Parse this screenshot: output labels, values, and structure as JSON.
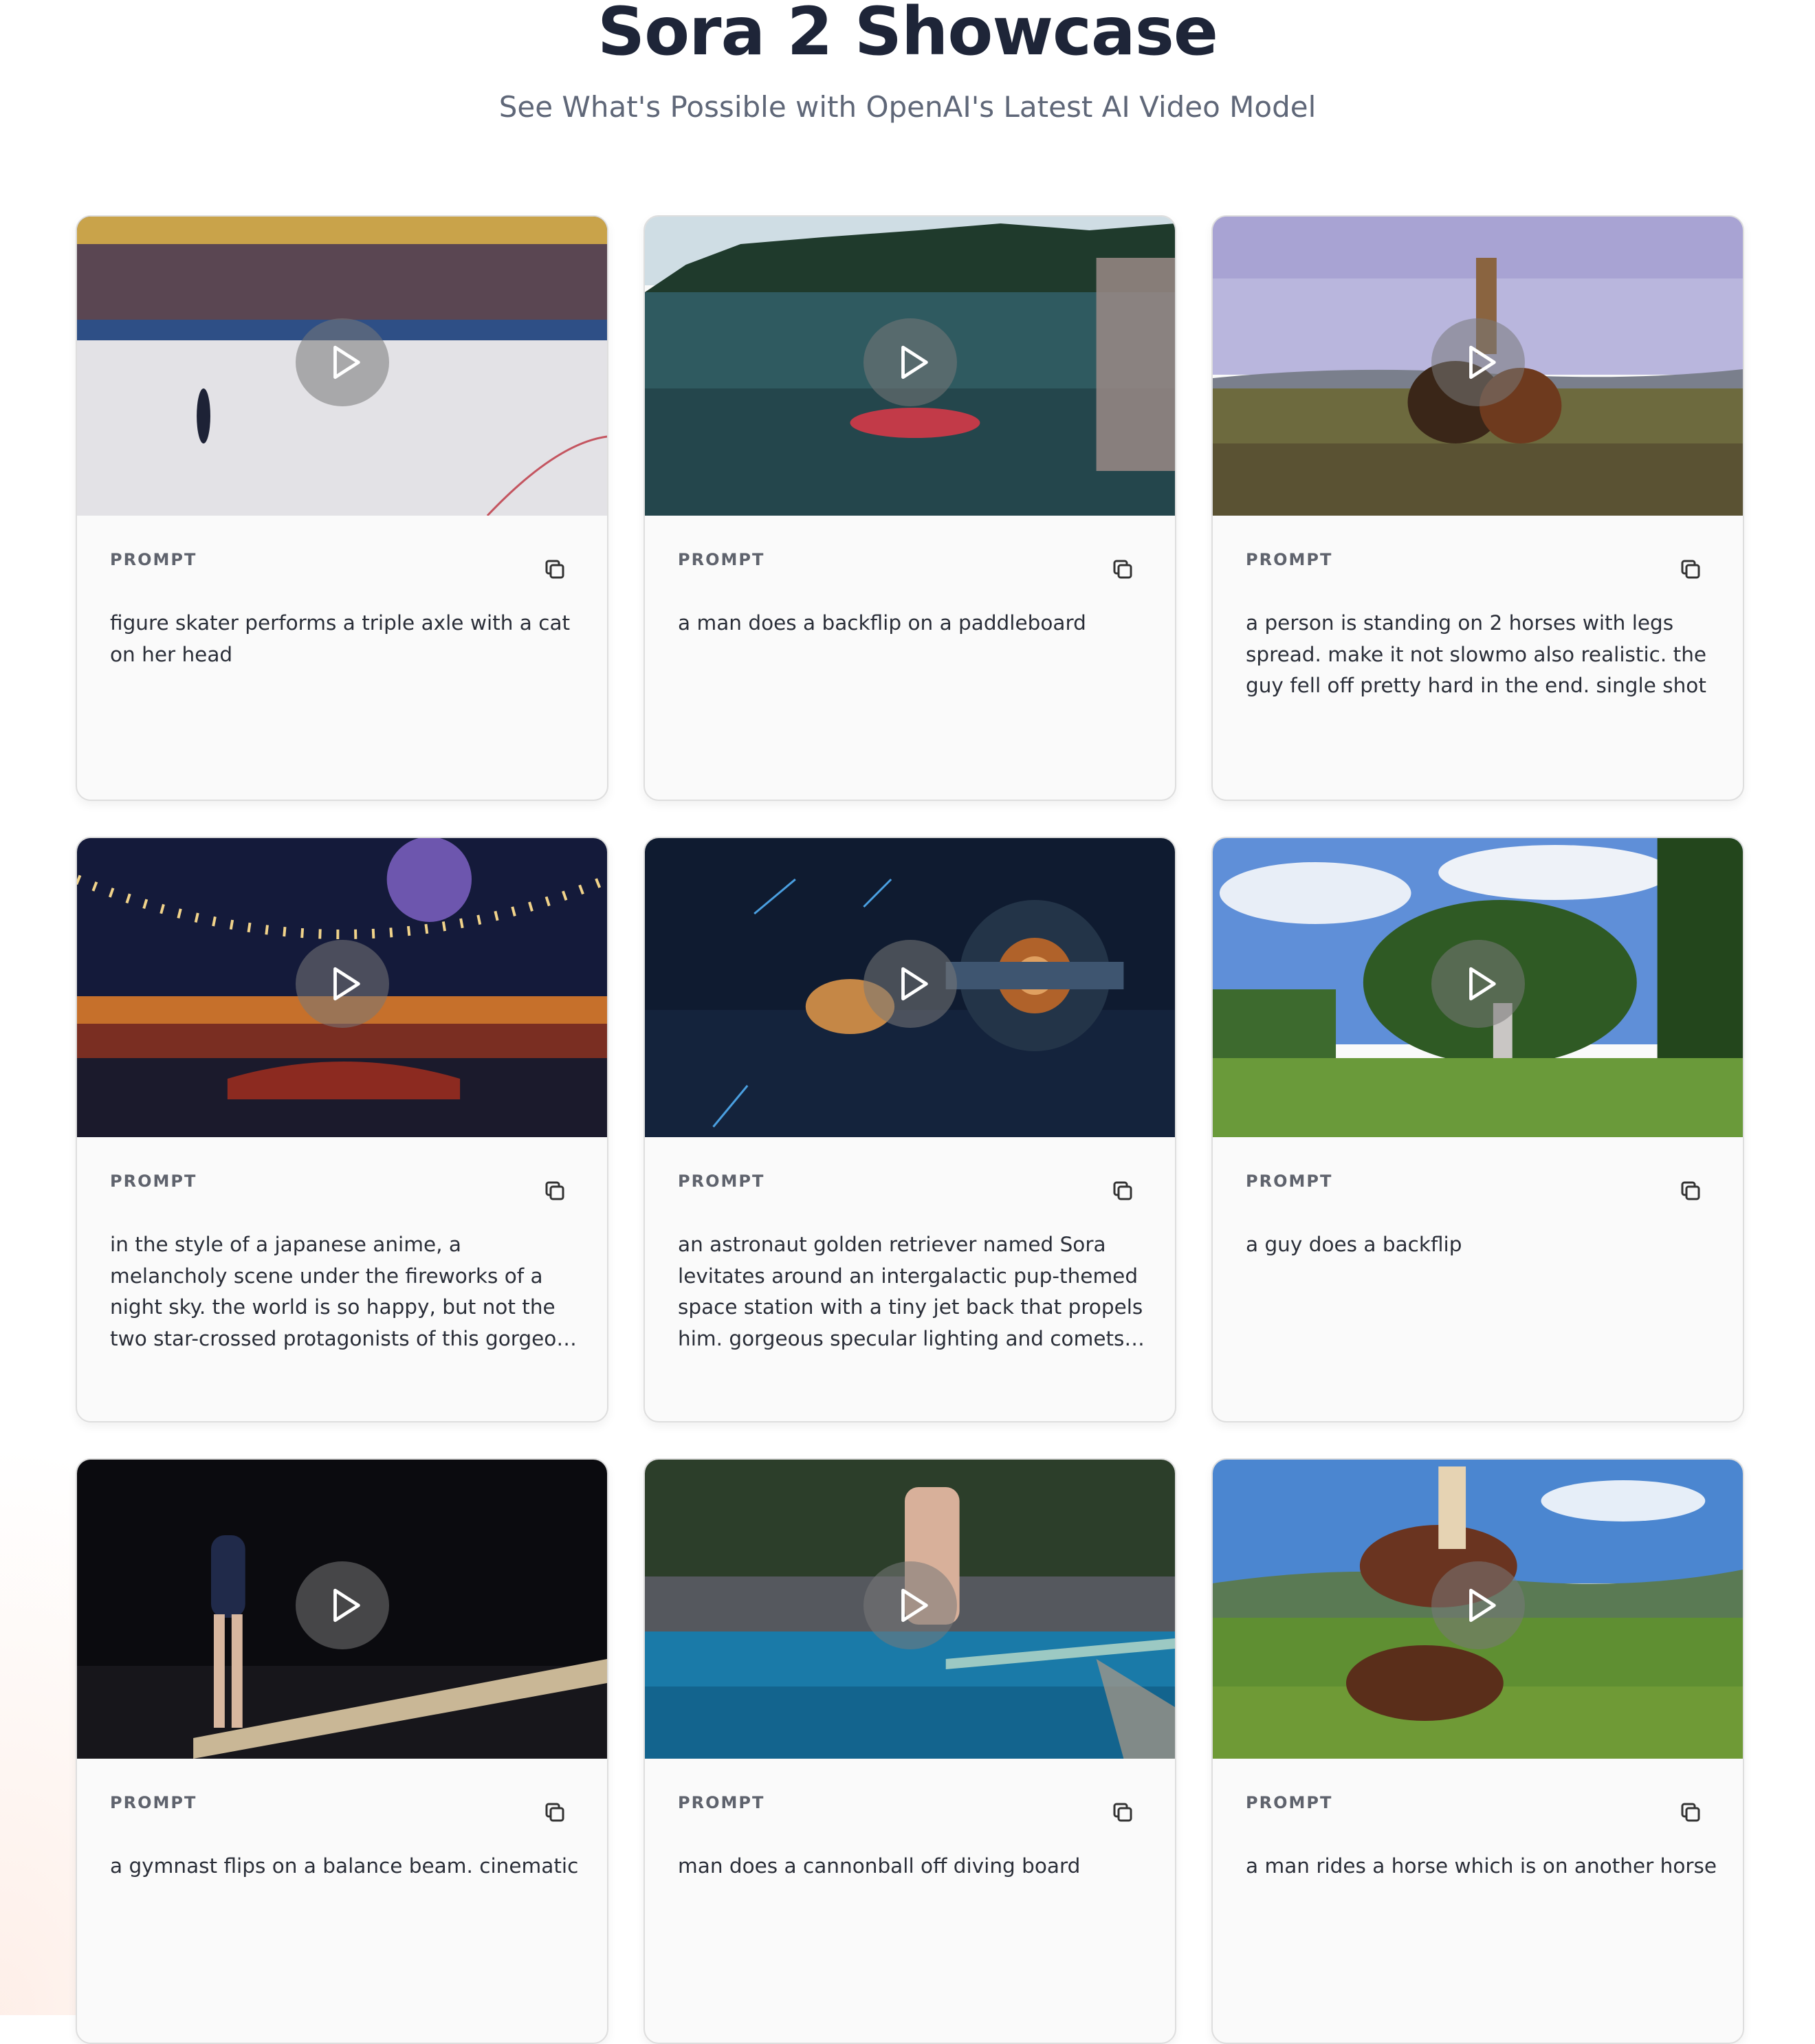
{
  "header": {
    "title": "Sora 2 Showcase",
    "subtitle": "See What's Possible with OpenAI's Latest AI Video Model"
  },
  "cards": [
    {
      "label": "PROMPT",
      "prompt": "figure skater performs a triple axle with a cat on her head",
      "thumb": "figure-skating-arena"
    },
    {
      "label": "PROMPT",
      "prompt": "a man does a backflip on a paddleboard",
      "thumb": "lake-paddleboard"
    },
    {
      "label": "PROMPT",
      "prompt": "a person is standing on 2 horses with legs spread. make it not slowmo also realistic. the guy fell off pretty hard in the end. single shot",
      "thumb": "man-on-two-horses"
    },
    {
      "label": "PROMPT",
      "prompt": "in the style of a japanese anime, a melancholy scene under the fireworks of a night sky. the world is so happy, but not the two star-crossed protagonists of this gorgeous japanese town in the middle of summer festivities",
      "thumb": "anime-festival-fireworks"
    },
    {
      "label": "PROMPT",
      "prompt": "an astronaut golden retriever named Sora levitates around an intergalactic pup-themed space station with a tiny jet back that propels him. gorgeous specular lighting and comets fly through the background",
      "thumb": "space-station-dog"
    },
    {
      "label": "PROMPT",
      "prompt": "a guy does a backflip",
      "thumb": "field-backflip"
    },
    {
      "label": "PROMPT",
      "prompt": "a gymnast flips on a balance beam. cinematic",
      "thumb": "gymnast-balance-beam"
    },
    {
      "label": "PROMPT",
      "prompt": "man does a cannonball off diving board",
      "thumb": "pool-diving-board"
    },
    {
      "label": "PROMPT",
      "prompt": "a man rides a horse which is on another horse",
      "thumb": "horse-on-horse"
    }
  ]
}
